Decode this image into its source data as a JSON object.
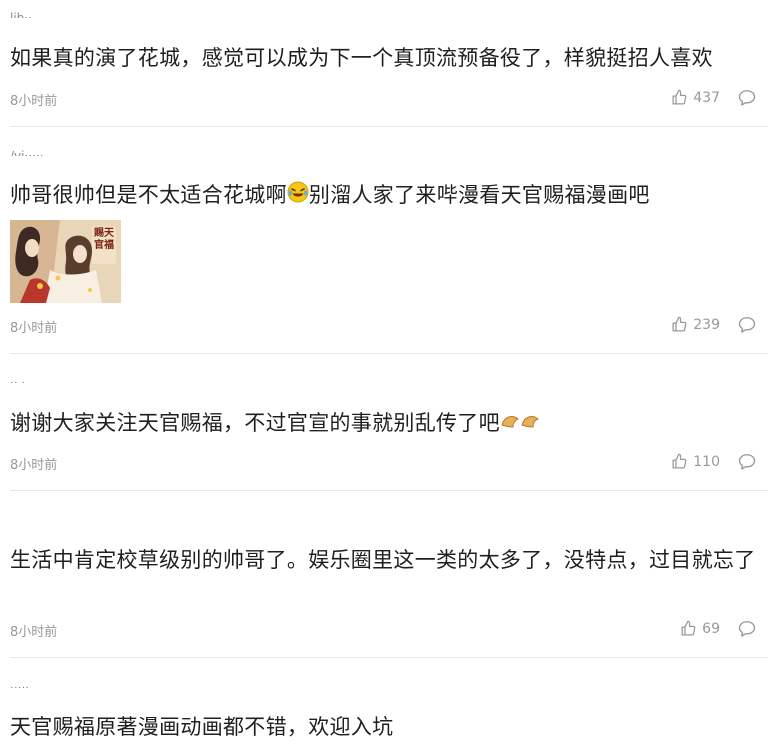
{
  "comments": [
    {
      "username": "lib··",
      "text": "如果真的演了花城，感觉可以成为下一个真顶流预备役了，样貌挺招人喜欢",
      "time": "8小时前",
      "likes": "437"
    },
    {
      "username": "/ⅴi·····",
      "text_before": "帅哥很帅但是不太适合花城啊",
      "emoji": "laughing-tears-emoji",
      "text_after": "别溜人家了来哔漫看天官赐福漫画吧",
      "image_caption": "赐天官福",
      "time": "8小时前",
      "likes": "239"
    },
    {
      "username": "·· ·",
      "text_before": "谢谢大家关注天官赐福，不过官宣的事就别乱传了吧",
      "emoji": "fortune-cookie-emoji",
      "time": "8小时前",
      "likes": "110"
    },
    {
      "username": "",
      "text": "生活中肯定校草级别的帅哥了。娱乐圈里这一类的太多了，没特点，过目就忘了",
      "time": "8小时前",
      "likes": "69"
    },
    {
      "username": "·····",
      "text": "天官赐福原著漫画动画都不错，欢迎入坑"
    }
  ]
}
